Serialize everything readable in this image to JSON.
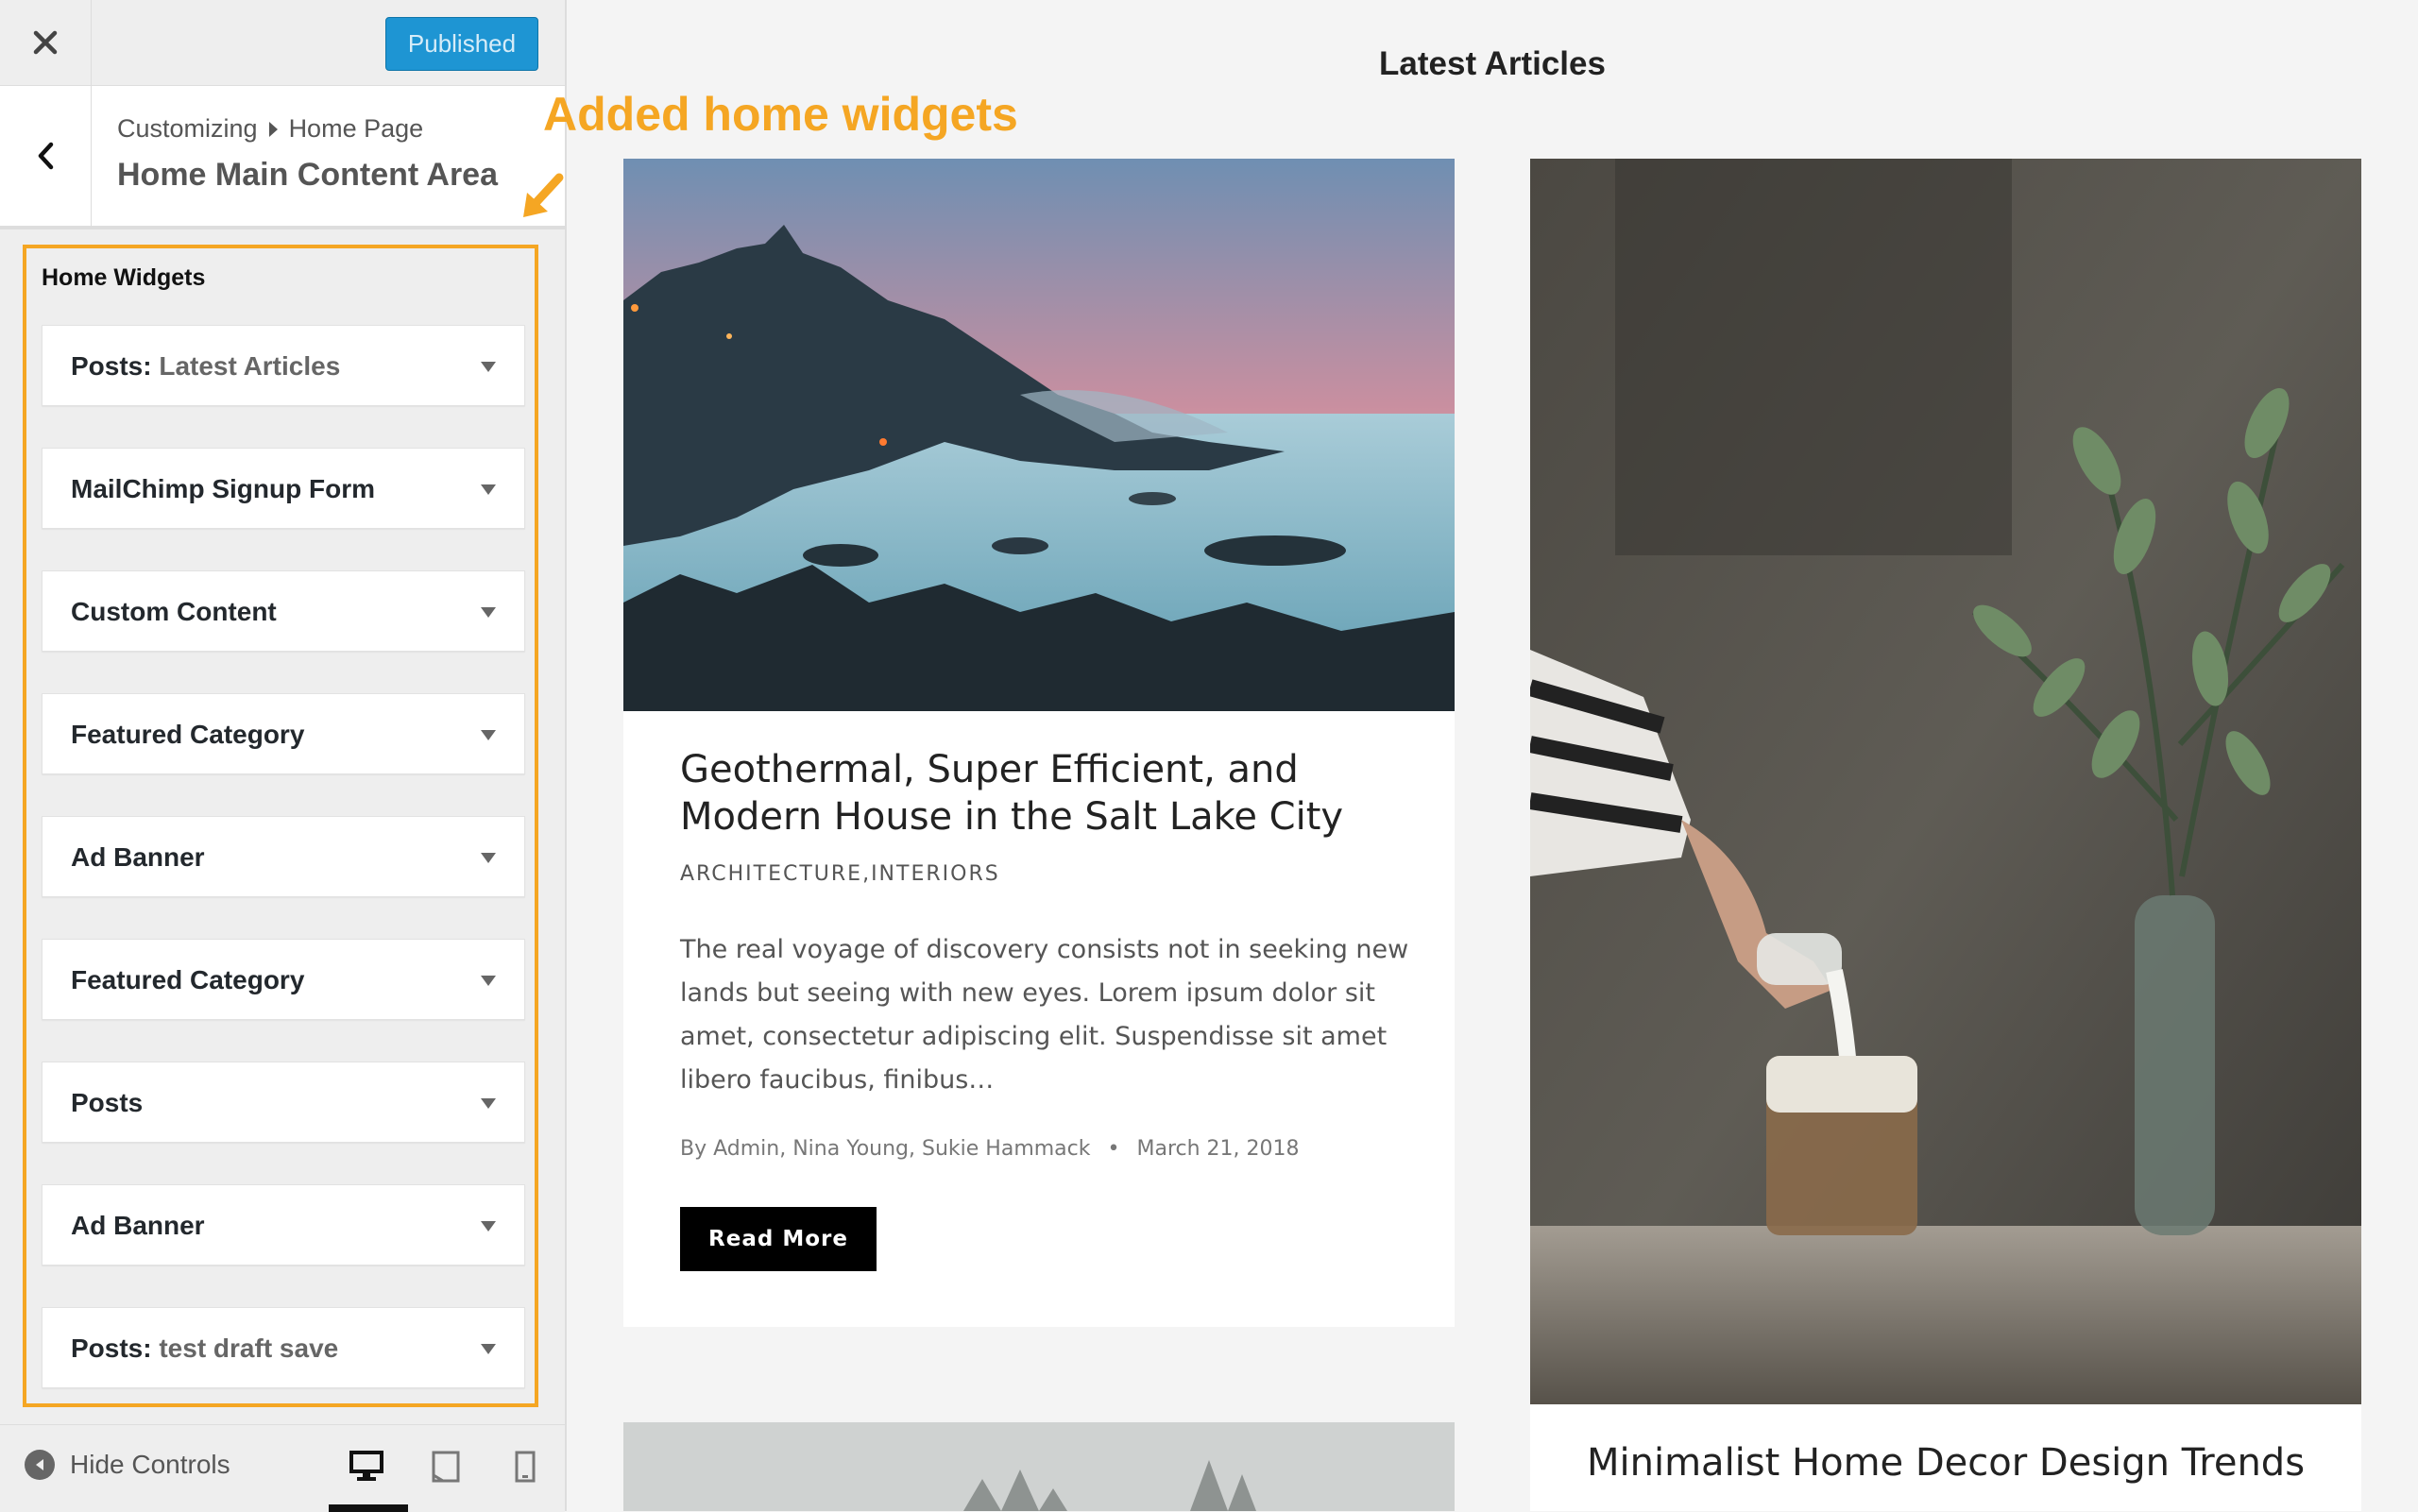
{
  "customizer": {
    "close_icon": "close-icon",
    "publish_label": "Published",
    "breadcrumb_root": "Customizing",
    "breadcrumb_page": "Home Page",
    "section_title": "Home Main Content Area",
    "widgets_heading": "Home Widgets",
    "widgets": [
      {
        "label": "Posts:",
        "sub": "Latest Articles"
      },
      {
        "label": "MailChimp Signup Form",
        "sub": ""
      },
      {
        "label": "Custom Content",
        "sub": ""
      },
      {
        "label": "Featured Category",
        "sub": ""
      },
      {
        "label": "Ad Banner",
        "sub": ""
      },
      {
        "label": "Featured Category",
        "sub": ""
      },
      {
        "label": "Posts",
        "sub": ""
      },
      {
        "label": "Ad Banner",
        "sub": ""
      },
      {
        "label": "Posts:",
        "sub": "test draft save"
      }
    ],
    "hide_controls_label": "Hide Controls",
    "devices": [
      "desktop-icon",
      "tablet-icon",
      "mobile-icon"
    ],
    "active_device": "desktop",
    "publish_color": "#1e95d3"
  },
  "annotation": {
    "text": "Added home widgets",
    "color": "#f5a623"
  },
  "preview": {
    "heading": "Latest Articles",
    "articles": [
      {
        "title": "Geothermal, Super Efficient, and Modern House in the Salt Lake City",
        "categories": [
          "ARCHITECTURE",
          "INTERIORS"
        ],
        "excerpt": "The real voyage of discovery consists not in seeking new lands but seeing with new eyes. Lorem ipsum dolor sit amet, consectetur adipiscing elit. Suspendisse sit amet libero faucibus, finibus…",
        "authors": "By Admin, Nina Young, Sukie Hammack",
        "separator": "•",
        "date": "March 21, 2018",
        "read_more": "Read More"
      },
      {
        "title": "Minimalist Home Decor Design Trends"
      }
    ]
  }
}
